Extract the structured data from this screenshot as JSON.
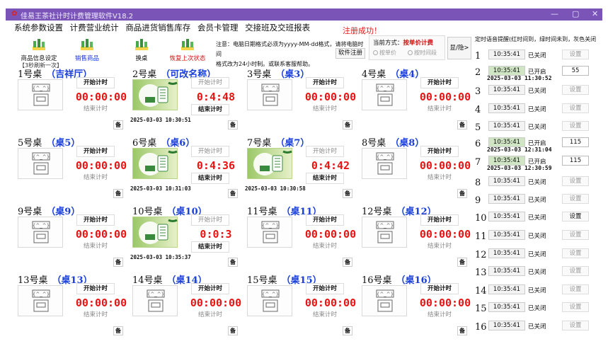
{
  "window": {
    "title": "佳易王茶社计时计费管理软件V18.2",
    "min": "—",
    "max": "▢",
    "close": "✕"
  },
  "menu": [
    "系统参数设置",
    "计费营业统计",
    "商品进货销售库存",
    "会员卡管理",
    "交接班及交班报表"
  ],
  "status": {
    "success": "注册成功！"
  },
  "toolbar": [
    {
      "label": "商品信息设定",
      "icon": "tea-bag-icon",
      "color": "#111"
    },
    {
      "label": "销售商品",
      "icon": "tea-bag-icon",
      "color": "#1a33d6"
    },
    {
      "label": "换桌",
      "icon": "tea-bag-icon",
      "color": "#111"
    },
    {
      "label": "恢复上次状态",
      "icon": "tea-bag-icon",
      "color": "#d01010"
    }
  ],
  "refresh": "【3秒刷新一次】",
  "notice": {
    "line1": "注意：电脑日期格式必须为yyyy-MM-dd格式，请将电脑时间",
    "line2": "格式改为24小时制。或联系客服帮助。",
    "register": "软件注册"
  },
  "billing": {
    "label": "当前方式：",
    "mode": "按单价计费",
    "opt1": "按单价",
    "opt2": "按时间段"
  },
  "toggle": "显/隐>",
  "table_labels": {
    "start": "开始计时",
    "end": "结束计时",
    "note": "备"
  },
  "tables": [
    {
      "name": "1号桌",
      "sub": "（吉祥厅）",
      "timer": "00:00:00",
      "active": false,
      "start": ""
    },
    {
      "name": "2号桌",
      "sub": "（可改名称）",
      "timer": "0:4:48",
      "active": true,
      "start": "2025-03-03 10:30:51"
    },
    {
      "name": "3号桌",
      "sub": "（桌3）",
      "timer": "00:00:00",
      "active": false,
      "start": ""
    },
    {
      "name": "4号桌",
      "sub": "（桌4）",
      "timer": "00:00:00",
      "active": false,
      "start": ""
    },
    {
      "name": "5号桌",
      "sub": "（桌5）",
      "timer": "00:00:00",
      "active": false,
      "start": ""
    },
    {
      "name": "6号桌",
      "sub": "（桌6）",
      "timer": "0:4:36",
      "active": true,
      "start": "2025-03-03 10:31:03"
    },
    {
      "name": "7号桌",
      "sub": "（桌7）",
      "timer": "0:4:42",
      "active": true,
      "start": "2025-03-03 10:30:58"
    },
    {
      "name": "8号桌",
      "sub": "（桌8）",
      "timer": "00:00:00",
      "active": false,
      "start": ""
    },
    {
      "name": "9号桌",
      "sub": "（桌9）",
      "timer": "00:00:00",
      "active": false,
      "start": ""
    },
    {
      "name": "10号桌",
      "sub": "（桌10）",
      "timer": "0:0:3",
      "active": true,
      "start": "2025-03-03 10:35:37"
    },
    {
      "name": "11号桌",
      "sub": "（桌11）",
      "timer": "00:00:00",
      "active": false,
      "start": ""
    },
    {
      "name": "12号桌",
      "sub": "（桌12）",
      "timer": "00:00:00",
      "active": false,
      "start": ""
    },
    {
      "name": "13号桌",
      "sub": "（桌13）",
      "timer": "00:00:00",
      "active": false,
      "start": ""
    },
    {
      "name": "14号桌",
      "sub": "（桌14）",
      "timer": "00:00:00",
      "active": false,
      "start": ""
    },
    {
      "name": "15号桌",
      "sub": "（桌15）",
      "timer": "00:00:00",
      "active": false,
      "start": ""
    },
    {
      "name": "16号桌",
      "sub": "（桌16）",
      "timer": "00:00:00",
      "active": false,
      "start": ""
    }
  ],
  "reminder": {
    "title": "定时语音提醒(红时间到，绿时间未到，灰色关闭",
    "set_label": "设置",
    "rows": [
      {
        "num": "1",
        "time": "10:35:41",
        "state": "已关闭",
        "on": false
      },
      {
        "num": "2",
        "time": "10:35:41",
        "state": "已开启",
        "on": true,
        "minutes": "55",
        "due": "2025-03-03 11:30:52"
      },
      {
        "num": "3",
        "time": "10:35:41",
        "state": "已关闭",
        "on": false
      },
      {
        "num": "4",
        "time": "10:35:41",
        "state": "已关闭",
        "on": false
      },
      {
        "num": "5",
        "time": "10:35:41",
        "state": "已关闭",
        "on": false
      },
      {
        "num": "6",
        "time": "10:35:41",
        "state": "已开启",
        "on": true,
        "minutes": "115",
        "due": "2025-03-03 12:31:04"
      },
      {
        "num": "7",
        "time": "10:35:41",
        "state": "已开启",
        "on": true,
        "minutes": "115",
        "due": "2025-03-03 12:30:59"
      },
      {
        "num": "8",
        "time": "10:35:41",
        "state": "已关闭",
        "on": false
      },
      {
        "num": "9",
        "time": "10:35:41",
        "state": "已关闭",
        "on": false
      },
      {
        "num": "10",
        "time": "10:35:41",
        "state": "已关闭",
        "on": false
      },
      {
        "num": "11",
        "time": "10:35:41",
        "state": "已关闭",
        "on": false
      },
      {
        "num": "12",
        "time": "10:35:41",
        "state": "已关闭",
        "on": false
      },
      {
        "num": "13",
        "time": "10:35:41",
        "state": "已关闭",
        "on": false
      },
      {
        "num": "14",
        "time": "10:35:41",
        "state": "已关闭",
        "on": false
      },
      {
        "num": "15",
        "time": "10:35:41",
        "state": "已关闭",
        "on": false
      },
      {
        "num": "16",
        "time": "10:35:41",
        "state": "已关闭",
        "on": false
      }
    ]
  }
}
